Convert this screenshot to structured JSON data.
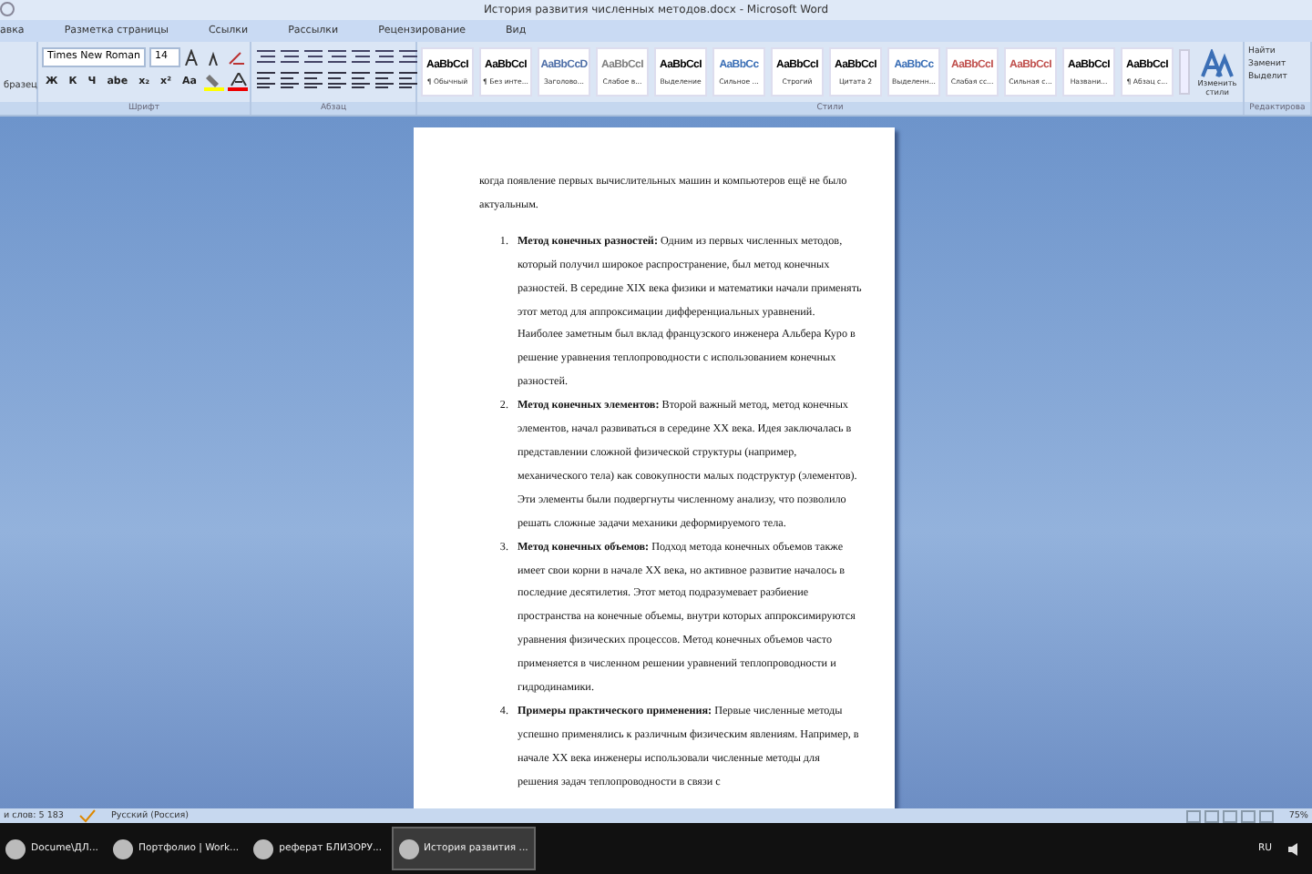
{
  "window": {
    "title": "История развития численных методов.docx - Microsoft Word"
  },
  "tabs": [
    {
      "label": "авка",
      "selected": false
    },
    {
      "label": "Разметка страницы",
      "selected": false
    },
    {
      "label": "Ссылки",
      "selected": false
    },
    {
      "label": "Рассылки",
      "selected": false
    },
    {
      "label": "Рецензирование",
      "selected": false
    },
    {
      "label": "Вид",
      "selected": false
    }
  ],
  "ribbon": {
    "clipboard_label": "бразец",
    "font_name": "Times New Roman",
    "font_size": "14",
    "format_buttons": [
      "Ж",
      "К",
      "Ч",
      "abe",
      "x₂",
      "x²",
      "Aa"
    ],
    "groups": [
      "Шрифт",
      "Абзац",
      "Стили",
      "Редактирова"
    ],
    "styles": [
      {
        "sample": "AaBbCcI",
        "label": "¶ Обычный",
        "color": "#000000"
      },
      {
        "sample": "AaBbCcI",
        "label": "¶ Без инте...",
        "color": "#000000"
      },
      {
        "sample": "AaBbCcD",
        "label": "Заголово...",
        "color": "#4f6fa8"
      },
      {
        "sample": "AaBbCcI",
        "label": "Слабое в...",
        "color": "#808080"
      },
      {
        "sample": "AaBbCcI",
        "label": "Выделение",
        "color": "#000000"
      },
      {
        "sample": "AaBbCc",
        "label": "Сильное ...",
        "color": "#3b6fb6"
      },
      {
        "sample": "AaBbCcI",
        "label": "Строгий",
        "color": "#000000"
      },
      {
        "sample": "AaBbCcI",
        "label": "Цитата 2",
        "color": "#000000"
      },
      {
        "sample": "AaBbCc",
        "label": "Выделенн...",
        "color": "#3b6fb6"
      },
      {
        "sample": "AaBbCcI",
        "label": "Слабая сс...",
        "color": "#c0504d"
      },
      {
        "sample": "AaBbCcI",
        "label": "Сильная с...",
        "color": "#c0504d"
      },
      {
        "sample": "AaBbCcI",
        "label": "Названи...",
        "color": "#000000"
      },
      {
        "sample": "AaBbCcI",
        "label": "¶ Абзац с...",
        "color": "#000000"
      }
    ],
    "change_styles": "Изменить стили",
    "editing": [
      "Найти",
      "Заменит",
      "Выделит"
    ]
  },
  "document": {
    "intro": "когда появление первых вычислительных машин и компьютеров ещё не было актуальным.",
    "items": [
      {
        "number": "1.",
        "text": "**Метод конечных разностей:** Одним из первых численных методов, который получил широкое распространение, был метод конечных разностей. В середине XIX века физики и математики начали применять этот метод для аппроксимации дифференциальных уравнений. Наиболее заметным был вклад французского инженера Альбера Куро в решение уравнения теплопроводности с использованием конечных разностей."
      },
      {
        "number": "2.",
        "text": "**Метод конечных элементов:** Второй важный метод, метод конечных элементов, начал развиваться в середине XX века. Идея заключалась в представлении сложной физической структуры (например, механического тела) как совокупности малых подструктур (элементов). Эти элементы были подвергнуты численному анализу, что позволило решать сложные задачи механики деформируемого тела."
      },
      {
        "number": "3.",
        "text": "**Метод конечных объемов:** Подход метода конечных объемов также имеет свои корни в начале XX века, но активное развитие началось в последние десятилетия. Этот метод подразумевает разбиение пространства на конечные объемы, внутри которых аппроксимируются уравнения физических процессов. Метод конечных объемов часто применяется в численном решении уравнений теплопроводности и гидродинамики."
      },
      {
        "number": "4.",
        "text": "**Примеры практического применения:** Первые численные методы успешно применялись к различным физическим явлениям. Например, в начале XX века инженеры использовали численные методы для решения задач теплопроводности в связи с"
      }
    ]
  },
  "status_bar": {
    "words": "и слов: 5 183",
    "language": "Русский (Россия)",
    "zoom": "75%"
  },
  "taskbar": {
    "items": [
      {
        "label": "Docume\\ДЛ...",
        "selected": false
      },
      {
        "label": "Портфолио | Work...",
        "selected": false
      },
      {
        "label": "реферат БЛИЗОРУ...",
        "selected": false
      },
      {
        "label": "История развития ...",
        "selected": true
      }
    ],
    "language": "RU"
  }
}
